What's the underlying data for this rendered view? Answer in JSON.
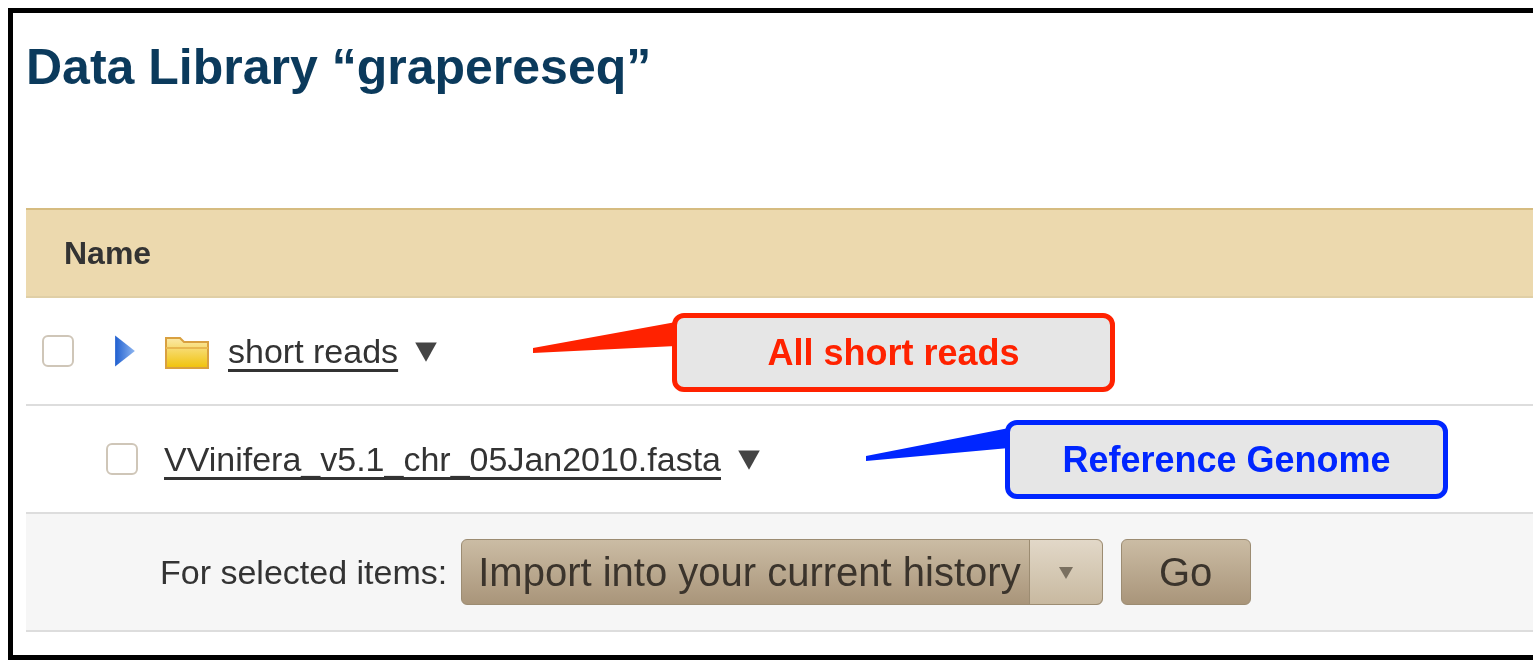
{
  "page": {
    "title": "Data Library “grapereseq”"
  },
  "table": {
    "columns": [
      "Name"
    ],
    "rows": [
      {
        "kind": "folder",
        "name": "short reads",
        "checked": false,
        "expanded": false
      },
      {
        "kind": "dataset",
        "name": "VVinifera_v5.1_chr_05Jan2010.fasta",
        "checked": false
      }
    ]
  },
  "actions": {
    "label": "For selected items:",
    "select_value": "Import into your current history",
    "button": "Go"
  },
  "annotations": [
    {
      "text": "All short reads",
      "color": "#ff2200"
    },
    {
      "text": "Reference Genome",
      "color": "#0026ff"
    }
  ]
}
